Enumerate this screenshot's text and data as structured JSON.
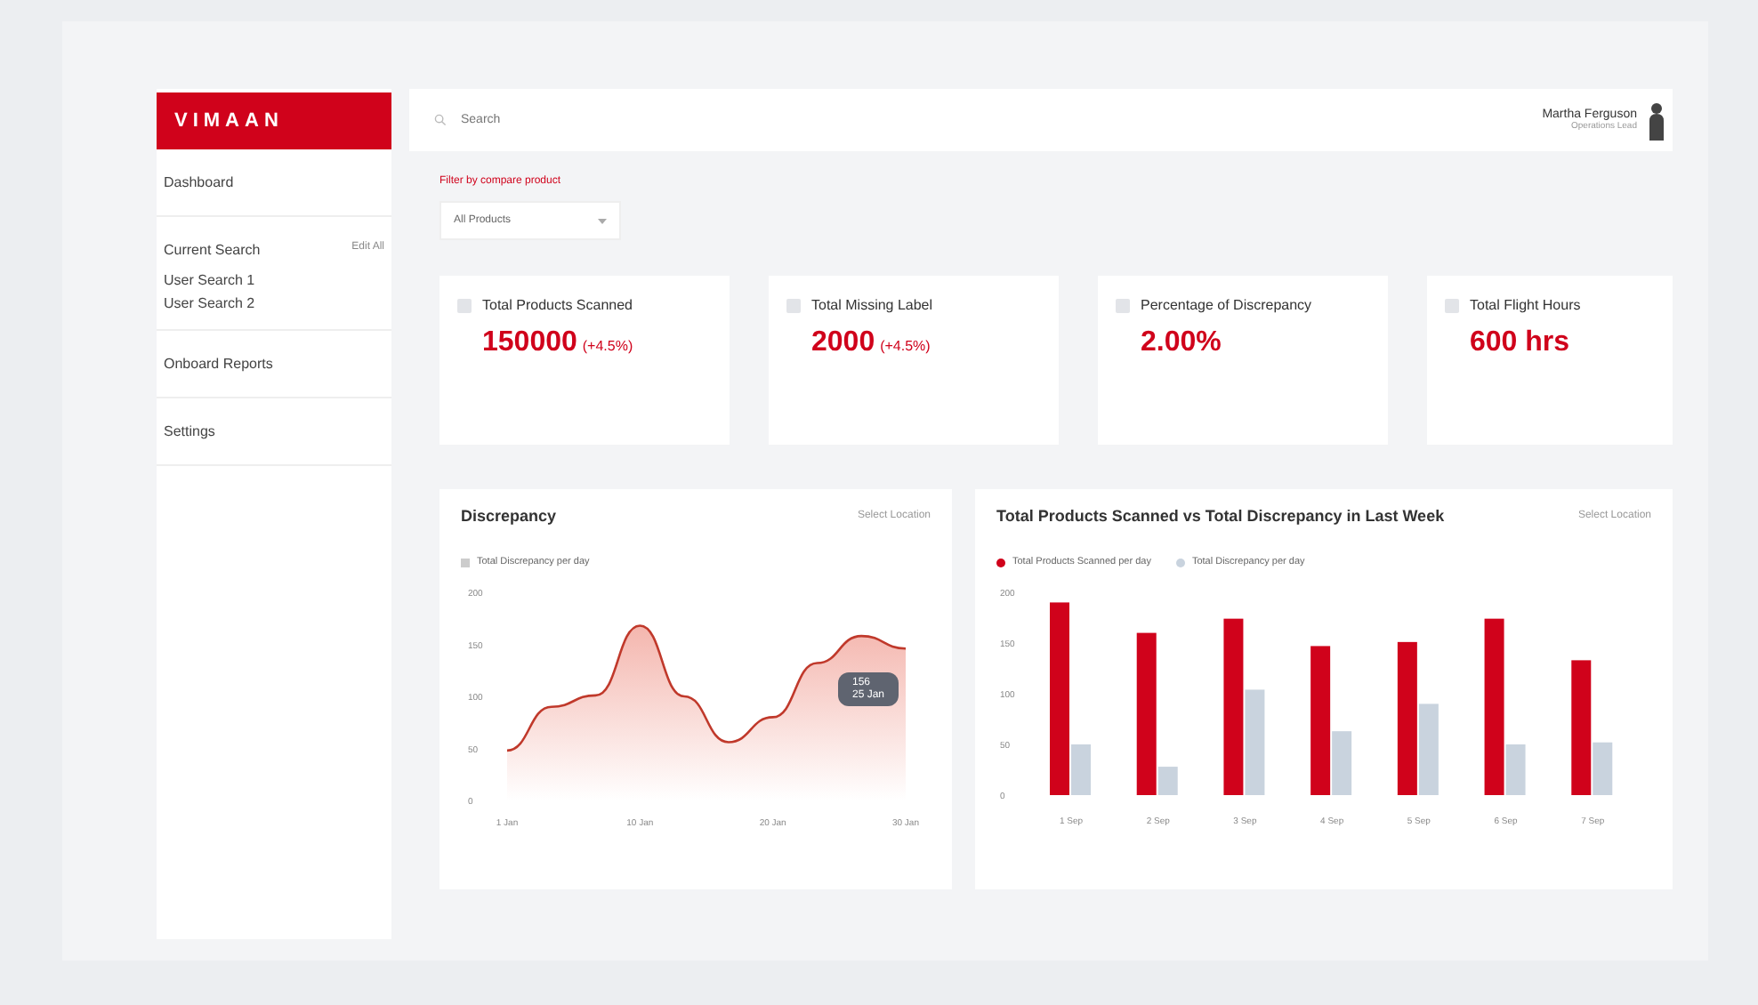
{
  "sidebar": {
    "logo": "VIMAAN",
    "items": [
      {
        "label": "Dashboard",
        "selected": false
      },
      {
        "label": "Current Search",
        "action": "Edit All",
        "selected": false,
        "children": [
          {
            "label": "User Search 1",
            "selected": false
          },
          {
            "label": "User Search 2",
            "selected": false
          }
        ]
      },
      {
        "label": "Onboard Reports",
        "selected": false
      },
      {
        "label": "Settings",
        "selected": false
      }
    ]
  },
  "topbar": {
    "search": {
      "placeholder": "Search"
    },
    "user": {
      "name": "Martha Ferguson",
      "role": "Operations Lead"
    }
  },
  "filter": {
    "label": "Filter by compare product",
    "value": "All Products"
  },
  "cards": [
    {
      "title": "Total Products Scanned",
      "value": "150000",
      "change": "(+4.5%)"
    },
    {
      "title": "Total Missing Label",
      "value": "2000",
      "change": "(+4.5%)"
    },
    {
      "title": "Percentage of Discrepancy",
      "value": "2.00%"
    },
    {
      "title": "Total Flight Hours",
      "value": "600 hrs"
    }
  ],
  "line_panel": {
    "title": "Discrepancy",
    "action": "Select Location",
    "tooltip": {
      "value": "156",
      "label": "25 Jan"
    },
    "chart_data": {
      "type": "area",
      "categories": [
        "1 Jan",
        null,
        null,
        "10 Jan",
        null,
        null,
        "20 Jan",
        null,
        null,
        "30 Jan"
      ],
      "series": [
        {
          "name": "Total Discrepancy per day",
          "color": "#c0392b",
          "values": [
            48,
            90,
            101,
            168,
            100,
            56,
            80,
            132,
            158,
            146
          ]
        }
      ],
      "ylim": [
        0,
        200
      ],
      "yticks": [
        0,
        50,
        100,
        150,
        200
      ]
    }
  },
  "bar_panel": {
    "title": "Total Products Scanned vs Total Discrepancy in Last Week",
    "action": "Select Location",
    "chart_data": {
      "type": "bar",
      "categories": [
        "1 Sep",
        "2 Sep",
        "3 Sep",
        "4 Sep",
        "5 Sep",
        "6 Sep",
        "7 Sep"
      ],
      "series": [
        {
          "name": "Total Products Scanned per day",
          "color": "#d0021b",
          "values": [
            190,
            160,
            174,
            147,
            151,
            174,
            133
          ]
        },
        {
          "name": "Total Discrepancy per day",
          "color": "#c9d3de",
          "values": [
            50,
            28,
            104,
            63,
            90,
            50,
            52
          ]
        }
      ],
      "ylim": [
        0,
        200
      ],
      "yticks": [
        0,
        50,
        100,
        150,
        200
      ]
    }
  }
}
